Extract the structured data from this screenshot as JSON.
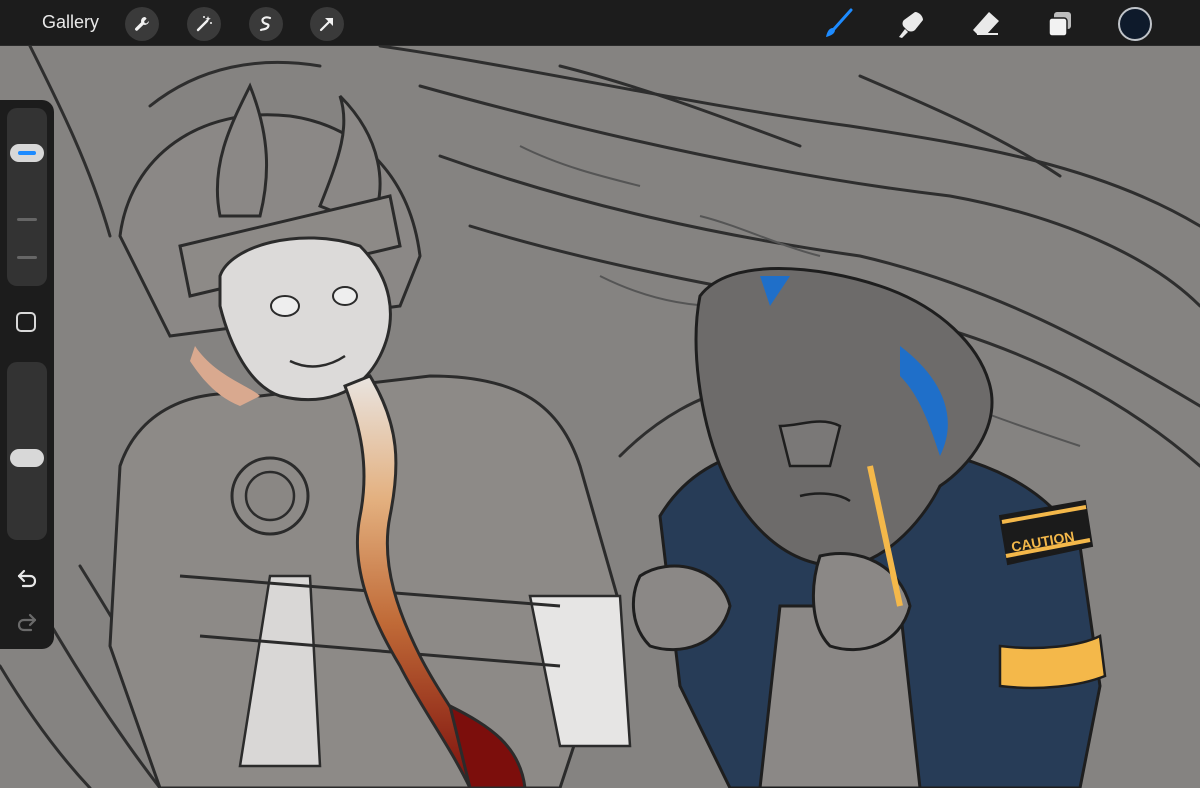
{
  "app": {
    "gallery_label": "Gallery"
  },
  "toolbar": {
    "left_tools": [
      "wrench-icon",
      "magic-wand-icon",
      "selection-icon",
      "transform-arrow-icon"
    ],
    "right_tools": [
      "brush-icon",
      "smudge-icon",
      "eraser-icon",
      "layers-icon"
    ],
    "active_tool": "brush-icon",
    "accent_color": "#1d8bff",
    "current_color": "#0e1a2b"
  },
  "sidebar": {
    "brush_size": 0.8,
    "opacity": 0.45,
    "modify_button": "square-modify-icon",
    "undo": "undo-icon",
    "redo": "redo-icon"
  },
  "canvas": {
    "armband_text": "CAUTION",
    "background_color": "#858381"
  }
}
